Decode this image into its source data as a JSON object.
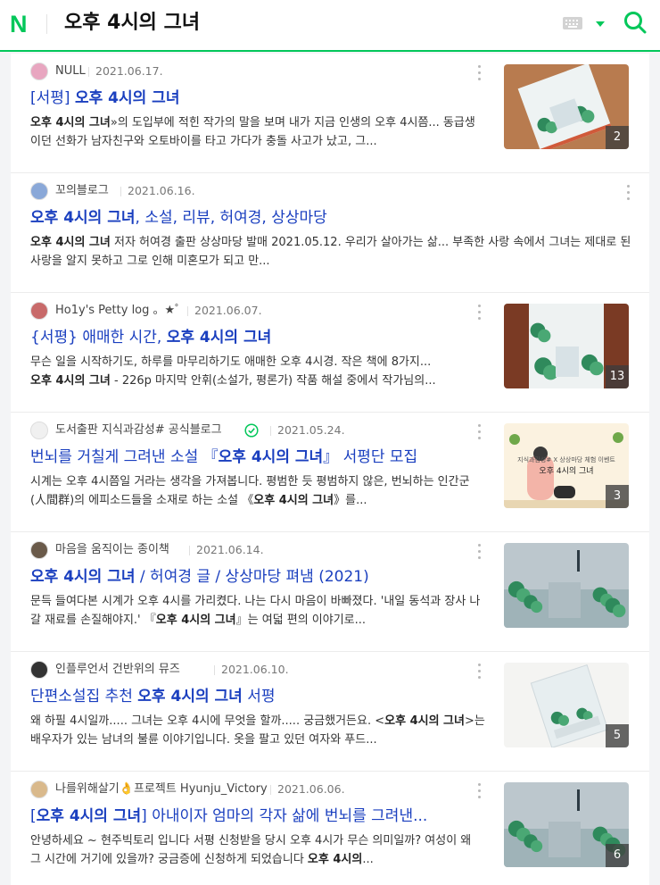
{
  "header": {
    "logo": "N",
    "query": "오후 4시의 그녀"
  },
  "results": [
    {
      "author": "NULL",
      "date": "2021.06.17.",
      "avatar_color": "#e8a6c0",
      "verified": false,
      "title": [
        {
          "t": "[서평] ",
          "b": false
        },
        {
          "t": "오후 4시의 그녀",
          "b": true
        }
      ],
      "desc": [
        {
          "t": "오후 4시의 그녀",
          "b": true
        },
        {
          "t": "»의 도입부에 적힌 작가의 말을 보며 내가 지금 인생의 오후 4시쯤... 동급생이던 선화가 남자친구와 오토바이를 타고 가다가 충돌 사고가 났고, 그...",
          "b": false
        }
      ],
      "thumb": {
        "count": "2",
        "style": "desk"
      }
    },
    {
      "author": "꼬의블로그",
      "date": "2021.06.16.",
      "avatar_color": "#8aa8d8",
      "verified": false,
      "title": [
        {
          "t": "오후 4시의 그녀",
          "b": true
        },
        {
          "t": ", 소설, 리뷰, 허여경, 상상마당",
          "b": false
        }
      ],
      "desc": [
        {
          "t": "오후 4시의 그녀",
          "b": true
        },
        {
          "t": " 저자 허여경 출판 상상마당 발매 2021.05.12. 우리가 살아가는 삶... 부족한 사랑 속에서 그녀는 제대로 된 사랑을 알지 못하고 그로 인해 미혼모가 되고 만...",
          "b": false
        }
      ],
      "thumb": null
    },
    {
      "author": "Ho1y's Petty log 。★゜",
      "date": "2021.06.07.",
      "avatar_color": "#c86a6a",
      "verified": false,
      "title": [
        {
          "t": "{서평} 애매한 시간, ",
          "b": false
        },
        {
          "t": "오후 4시의 그녀",
          "b": true
        }
      ],
      "desc": [
        {
          "t": "무슨 일을 시작하기도, 하루를 마무리하기도 애매한 오후 4시경. 작은 책에 8가지...",
          "b": false
        },
        {
          "t": "\n",
          "b": false
        },
        {
          "t": "오후 4시의 그녀",
          "b": true
        },
        {
          "t": " - 226p 마지막 안휘(소설가, 평론가) 작품 해설 중에서 작가님의...",
          "b": false
        }
      ],
      "thumb": {
        "count": "13",
        "style": "wood"
      }
    },
    {
      "author": "도서출판 지식과감성# 공식블로그",
      "date": "2021.05.24.",
      "avatar_color": "#f0f0f0",
      "verified": true,
      "title": [
        {
          "t": "번뇌를 거칠게 그려낸 소설 『",
          "b": false
        },
        {
          "t": "오후 4시의 그녀",
          "b": true
        },
        {
          "t": "』 서평단 모집",
          "b": false
        }
      ],
      "desc": [
        {
          "t": "시계는 오후 4시쯤일 거라는 생각을 가져봅니다. 평범한 듯 평범하지 않은, 번뇌하는 인간군(人間群)의 에피소드들을 소재로 하는 소설 《",
          "b": false
        },
        {
          "t": "오후 4시의 그녀",
          "b": true
        },
        {
          "t": "》를...",
          "b": false
        }
      ],
      "thumb": {
        "count": "3",
        "style": "banner",
        "caption1": "지식과감성# X 상상마당 체험 이벤트",
        "caption2": "오후 4시의 그녀"
      }
    },
    {
      "author": "마음을 움직이는 종이책",
      "date": "2021.06.14.",
      "avatar_color": "#6a5a4a",
      "verified": false,
      "title": [
        {
          "t": "오후 4시의 그녀",
          "b": true
        },
        {
          "t": " / 허여경 글 / 상상마당 펴냄 (2021)",
          "b": false
        }
      ],
      "desc": [
        {
          "t": "문득 들여다본 시계가 오후 4시를 가리켰다. 나는 다시 마음이 바빠졌다. '내일 동석과 장사 나갈 재료를 손질해야지.' 『",
          "b": false
        },
        {
          "t": "오후 4시의 그녀",
          "b": true
        },
        {
          "t": "』는 여덟 편의 이야기로...",
          "b": false
        }
      ],
      "thumb": {
        "count": "",
        "style": "cover"
      }
    },
    {
      "author": "인플루언서 건반위의 뮤즈",
      "date": "2021.06.10.",
      "avatar_color": "#333333",
      "verified": false,
      "title": [
        {
          "t": "단편소설집 추천 ",
          "b": false
        },
        {
          "t": "오후 4시의 그녀",
          "b": true
        },
        {
          "t": " 서평",
          "b": false
        }
      ],
      "desc": [
        {
          "t": "왜 하필 4시일까..... 그녀는 오후 4시에 무엇을 할까..... 궁금했거든요. <",
          "b": false
        },
        {
          "t": "오후 4시의 그녀",
          "b": true
        },
        {
          "t": ">는 배우자가 있는 남녀의 불륜 이야기입니다. 옷을 팔고 있던 여자와 푸드...",
          "b": false
        }
      ],
      "thumb": {
        "count": "5",
        "style": "white"
      }
    },
    {
      "author": "나를위해살기👌프로젝트 Hyunju_Victory",
      "date": "2021.06.06.",
      "avatar_color": "#d9b98c",
      "verified": false,
      "title": [
        {
          "t": "[",
          "b": false
        },
        {
          "t": "오후 4시의 그녀",
          "b": true
        },
        {
          "t": "] 아내이자 엄마의 각자 삶에 번뇌를 그려낸...",
          "b": false
        }
      ],
      "desc": [
        {
          "t": "안녕하세요 ~ 현주빅토리 입니다 서평 신청받을 당시 오후 4시가 무슨 의미일까? 여성이 왜 그 시간에 거기에 있을까? 궁금증에 신청하게 되었습니다 ",
          "b": false
        },
        {
          "t": "오후 4시의",
          "b": true
        },
        {
          "t": "...",
          "b": false
        }
      ],
      "thumb": {
        "count": "6",
        "style": "cover"
      }
    }
  ],
  "colors": {
    "brand": "#03c75a",
    "title": "#1a3fbf"
  },
  "icons": {
    "keyboard": "keyboard-icon",
    "dropdown": "caret-down-icon",
    "search": "search-icon",
    "more": "more-vertical-icon"
  }
}
